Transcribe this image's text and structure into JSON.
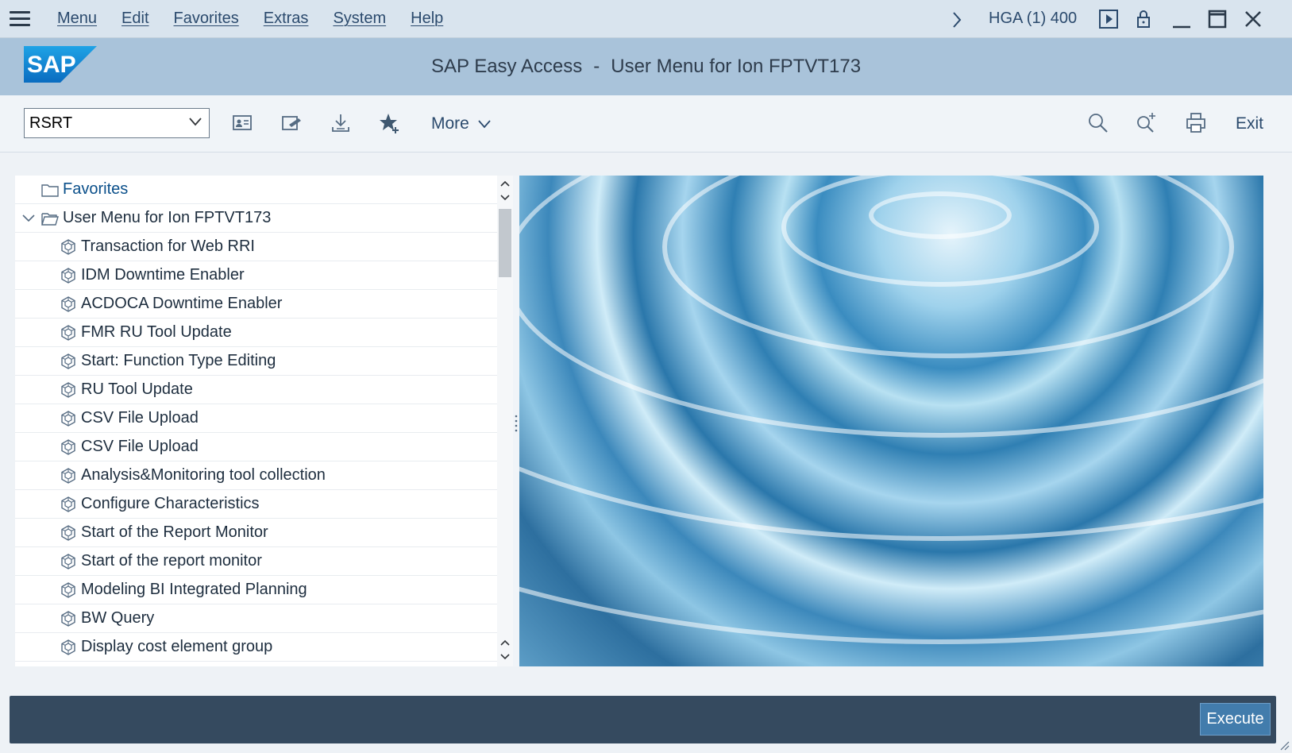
{
  "menubar": {
    "items": [
      "Menu",
      "Edit",
      "Favorites",
      "Extras",
      "System",
      "Help"
    ],
    "system_info": "HGA (1) 400"
  },
  "header": {
    "title_left": "SAP Easy Access",
    "title_sep": "-",
    "title_right": "User Menu for Ion FPTVT173",
    "logo_text": "SAP"
  },
  "toolbar": {
    "command_value": "RSRT",
    "more_label": "More",
    "exit_label": "Exit"
  },
  "tree": {
    "favorites_label": "Favorites",
    "user_menu_label": "User Menu for Ion FPTVT173",
    "items": [
      "Transaction for Web RRI",
      "IDM Downtime Enabler",
      "ACDOCA Downtime Enabler",
      "FMR RU Tool Update",
      "Start: Function Type Editing",
      "RU Tool Update",
      "CSV File Upload",
      "CSV File Upload",
      "Analysis&Monitoring tool collection",
      "Configure Characteristics",
      "Start of the Report Monitor",
      "Start of the report monitor",
      "Modeling BI Integrated Planning",
      "BW Query",
      "Display cost element group"
    ]
  },
  "footer": {
    "execute_label": "Execute"
  },
  "colors": {
    "menubar_bg": "#d9e4ee",
    "header_bg": "#a9c3da",
    "bottombar_bg": "#354a5f",
    "execute_bg": "#427cac",
    "link_text": "#2b4a6d"
  }
}
